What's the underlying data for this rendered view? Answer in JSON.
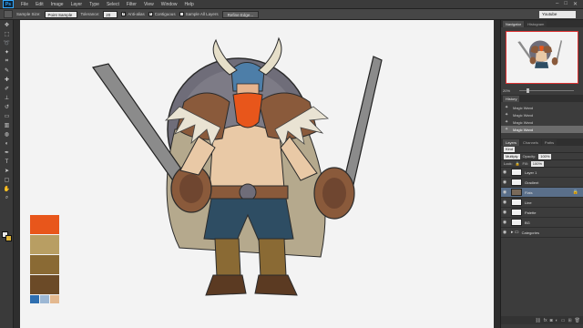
{
  "app": {
    "logo": "Ps"
  },
  "menu": [
    "File",
    "Edit",
    "Image",
    "Layer",
    "Type",
    "Select",
    "Filter",
    "View",
    "Window",
    "Help"
  ],
  "options": {
    "sample_size_label": "Sample Size:",
    "sample_size_value": "Point Sample",
    "tolerance_label": "Tolerance:",
    "tolerance_value": "20",
    "antialias_label": "Anti-alias",
    "contiguous_label": "Contiguous",
    "sample_all_label": "Sample All Layers",
    "refine_edge_label": "Refine Edge...",
    "workspace": "Youtube"
  },
  "palette_colors": [
    "#e8561b",
    "#b89e63",
    "#8a6a34",
    "#6b4a27"
  ],
  "palette_small_colors": [
    "#2f6fb0",
    "#9cb7d4",
    "#e3b88f"
  ],
  "navigator": {
    "tabs": [
      "Navigator",
      "Histogram"
    ],
    "zoom": "20%"
  },
  "history": {
    "tab": "History",
    "items": [
      "Magic Wand",
      "Magic Wand",
      "Magic Wand",
      "Magic Wand"
    ]
  },
  "layers": {
    "tabs": [
      "Layers",
      "Channels",
      "Paths"
    ],
    "kind_label": "Kind",
    "blend_mode": "Multiply",
    "opacity_label": "Opacity:",
    "opacity_value": "100%",
    "lock_label": "Lock:",
    "fill_label": "Fill:",
    "fill_value": "100%",
    "items": [
      {
        "name": "Layer 1"
      },
      {
        "name": "Gradient"
      },
      {
        "name": "Flats"
      },
      {
        "name": "Line"
      },
      {
        "name": "Palette"
      },
      {
        "name": "BG"
      },
      {
        "name": "Categories"
      }
    ]
  }
}
